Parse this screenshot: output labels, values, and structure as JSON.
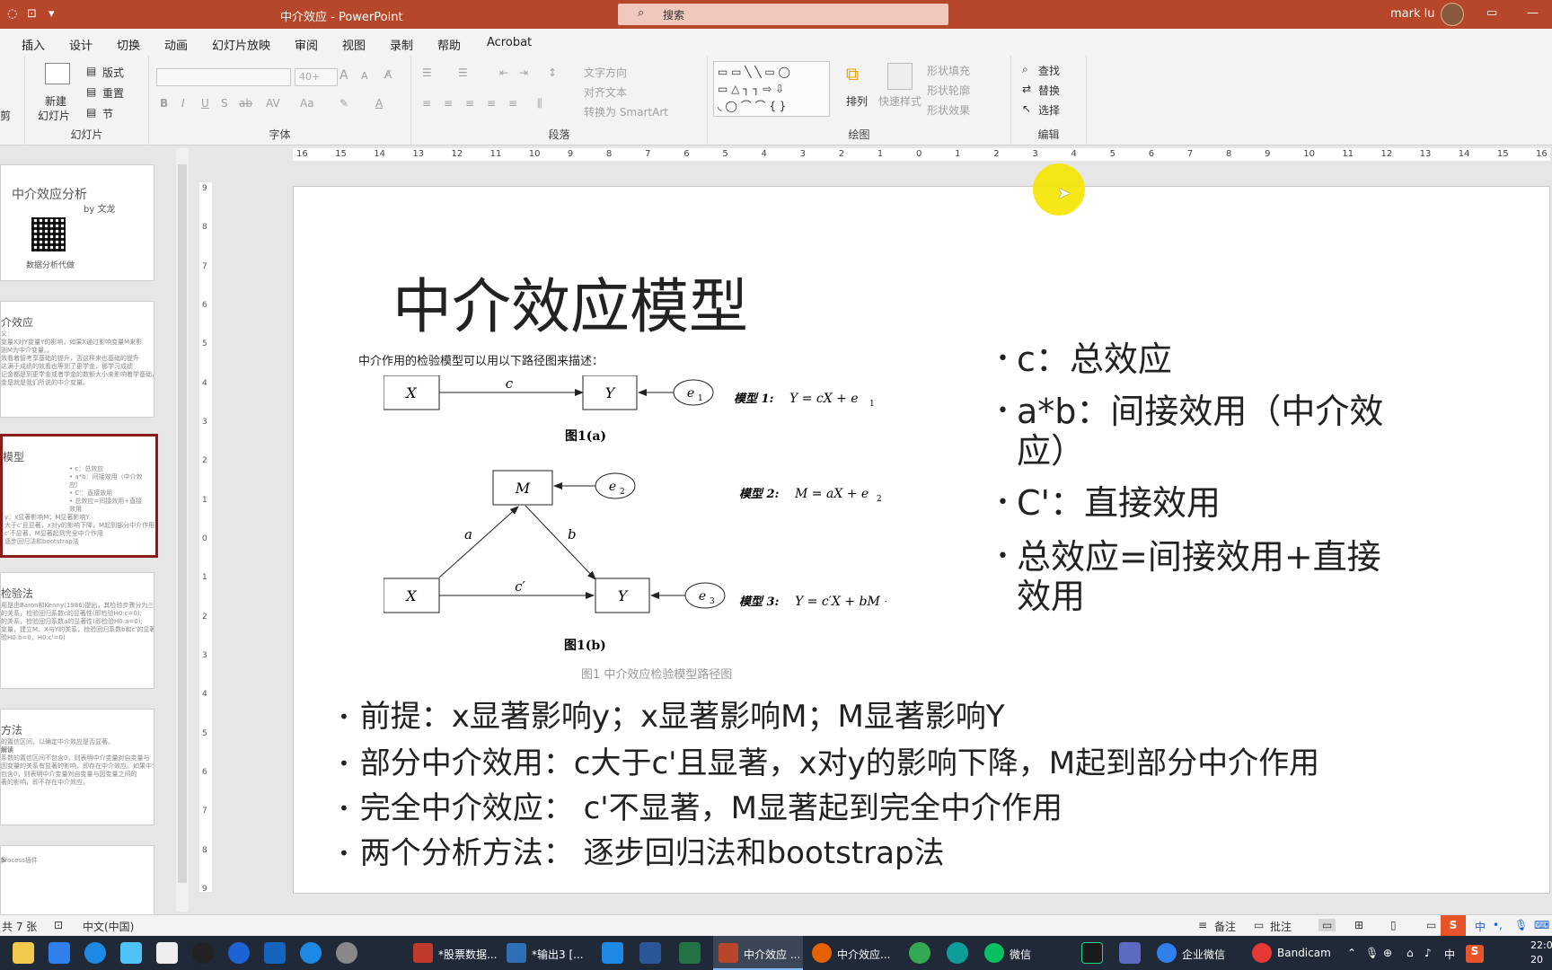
{
  "titlebar": {
    "doc_title": "中介效应 - PowerPoint",
    "search_placeholder": "搜索",
    "user": "mark lu"
  },
  "menu": [
    "插入",
    "设计",
    "切换",
    "动画",
    "幻灯片放映",
    "审阅",
    "视图",
    "录制",
    "帮助",
    "Acrobat"
  ],
  "ribbon": {
    "slides": {
      "new_slide": "新建",
      "new_slide2": "幻灯片",
      "layout": "版式",
      "reset": "重置",
      "section": "节",
      "group": "幻灯片",
      "clip": "剪"
    },
    "font": {
      "font_size": "40+",
      "group": "字体",
      "b": "B",
      "i": "I",
      "u": "U",
      "s": "S",
      "abc": "ab",
      "av": "AV",
      "aa": "Aa",
      "a": "A",
      "grow": "A",
      "shrink": "A"
    },
    "paragraph": {
      "text_direction": "文字方向",
      "align_text": "对齐文本",
      "smartart": "转换为 SmartArt",
      "group": "段落"
    },
    "drawing": {
      "arrange": "排列",
      "quick_styles": "快速样式",
      "fill": "形状填充",
      "outline": "形状轮廓",
      "effects": "形状效果",
      "group": "绘图"
    },
    "editing": {
      "find": "查找",
      "replace": "替换",
      "select": "选择",
      "group": "编辑"
    }
  },
  "thumbnails": [
    {
      "title": "中介效应分析",
      "sub": "by  文龙",
      "foot": "数据分析代做"
    },
    {
      "title": "介效应",
      "lines": [
        "义：",
        "变量X对Y变量Y的影响，如果X通过影响变量M来影",
        "则M为中介变量。。",
        "",
        "效看着智考享基础的提升，否这样来也基础的提升",
        "达满于成绩的效看也等到了更学金，那学习成绩",
        "记金都是到更学金或者学金的数额大小来影响着学基础，",
        "金是就是我们所说的中介变量。"
      ]
    },
    {
      "title": "模型",
      "lines": [
        "",
        "• c：总效应",
        "• a*b：间接效用（中介效",
        "  应）",
        "• C'：直接效用",
        "• 总效应=间接效用+直接",
        "  效用",
        "",
        "y；x显著影响M；M显著影响Y",
        "大于c'且显著，x对y的影响下降，M起到部分中介作用",
        "c'不显著，M显著起到完全中介作用",
        "逐步回归法和bootstrap法"
      ]
    },
    {
      "title": "检验法",
      "lines": [
        "",
        "用是由Baron和Kenny(1986)提出，其检验步骤分为三",
        "",
        "的关系，检验回归系数c的显著性(即检验H0:c=0);",
        "的关系，检验回归系数a的显著性(即检验H0:a=0);",
        "变量，建立M、X与Y的关系，检验回归系数b和c'的显著",
        "验H0:b=0，H0:c'=0)"
      ]
    },
    {
      "title": "方法",
      "lines": [
        "",
        "的置信区间，以确定中介效应是否显著。",
        "",
        "解读",
        "系数的置信区间不包含0，则表明中介变量对自变量与",
        "因变量的关系有显著的影响，即存在中介效应。如果中介效",
        "包含0，则表明中介变量对自变量与因变量之间的",
        "著的影响，即不存在中介效应。"
      ]
    },
    {
      "title": "s",
      "lines": [
        "",
        "",
        "",
        "",
        "",
        "",
        "",
        "process插件"
      ]
    }
  ],
  "slide": {
    "title": "中介效应模型",
    "intro": "中介作用的检验模型可以用以下路径图来描述：",
    "figure": {
      "x": "X",
      "y": "Y",
      "m": "M",
      "c": "c",
      "a": "a",
      "b": "b",
      "cprime": "c′",
      "e1": "e",
      "e2": "e",
      "e3": "e",
      "s1": "1",
      "s2": "2",
      "s3": "3",
      "fig1a": "图1(a)",
      "fig1b": "图1(b)",
      "model1": "模型 1:",
      "model1_eq": "Y = cX + e",
      "model2": "模型 2:",
      "model2_eq": "M = aX + e",
      "model3": "模型 3:",
      "model3_eq": "Y = c′X + bM + e"
    },
    "caption": "图1 中介效应检验模型路径图",
    "right_bullets": [
      "c：总效应",
      "a*b：间接效用（中介效应）",
      "C'：直接效用",
      "总效应=间接效用+直接效用"
    ],
    "bottom_bullets": [
      "前提：x显著影响y；x显著影响M；M显著影响Y",
      "部分中介效用：c大于c'且显著，x对y的影响下降，M起到部分中介作用",
      "完全中介效应：  c'不显著，M显著起到完全中介作用",
      "两个分析方法：   逐步回归法和bootstrap法"
    ]
  },
  "ruler": {
    "h_ticks": [
      "16",
      "15",
      "14",
      "13",
      "12",
      "11",
      "10",
      "9",
      "8",
      "7",
      "6",
      "5",
      "4",
      "3",
      "2",
      "1",
      "0",
      "1",
      "2",
      "3",
      "4",
      "5",
      "6",
      "7",
      "8",
      "9",
      "10",
      "11",
      "12",
      "13",
      "14",
      "15",
      "16"
    ],
    "v_ticks": [
      "9",
      "8",
      "7",
      "6",
      "5",
      "4",
      "3",
      "2",
      "1",
      "0",
      "1",
      "2",
      "3",
      "4",
      "5",
      "6",
      "7",
      "8",
      "9"
    ]
  },
  "status": {
    "slide_count": "共 7 张",
    "language": "中文(中国)",
    "notes": "备注",
    "comments": "批注"
  },
  "taskbar": {
    "apps": [
      "*股票数据...",
      "*输出3 [...",
      "中介效应 ...",
      "中介效应...",
      "微信",
      "企业微信",
      "Bandicam"
    ],
    "time": "22:0",
    "date": "20",
    "ime": "中"
  },
  "colors": {
    "accent": "#b7472a",
    "selected_thumb": "#8b1a1a",
    "cursor_highlight": "#f5e400"
  }
}
